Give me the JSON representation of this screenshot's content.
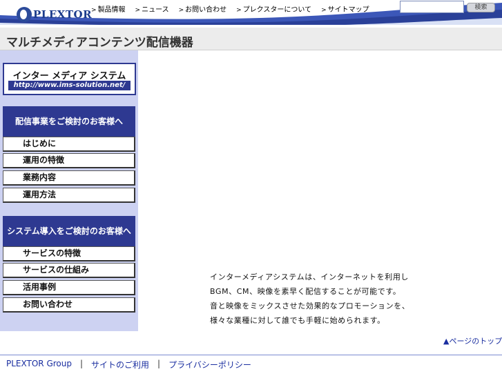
{
  "header": {
    "logo_text": "PLEXTOR",
    "nav": [
      {
        "label": "製品情報"
      },
      {
        "label": "ニュース"
      },
      {
        "label": "お問い合わせ"
      },
      {
        "label": "プレクスターについて"
      },
      {
        "label": "サイトマップ"
      }
    ],
    "search": {
      "value": "",
      "button_label": "検索"
    }
  },
  "page": {
    "title": "マルチメディアコンテンツ配信機器"
  },
  "sidebar": {
    "banner": {
      "title": "インター メディア システム",
      "url": "http://www.ims-solution.net/"
    },
    "section1": {
      "heading": "配信事業をご検討のお客様へ",
      "items": [
        {
          "label": "はじめに"
        },
        {
          "label": "運用の特徴"
        },
        {
          "label": "業務内容"
        },
        {
          "label": "運用方法"
        }
      ]
    },
    "section2": {
      "heading": "システム導入をご検討のお客様へ",
      "items": [
        {
          "label": "サービスの特徴"
        },
        {
          "label": "サービスの仕組み"
        },
        {
          "label": "活用事例"
        },
        {
          "label": "お問い合わせ"
        }
      ]
    }
  },
  "main": {
    "intro_lines": [
      "インターメディアシステムは、インターネットを利用し",
      "BGM、CM、映像を素早く配信することが可能です。",
      "音と映像をミックスさせた効果的なプロモーションを、",
      "様々な業種に対して誰でも手軽に始められます。"
    ],
    "page_top_label": "▲ページのトップへ"
  },
  "footer": {
    "group_label": "PLEXTOR Group",
    "link1": "サイトのご利用",
    "link2": "プライバシーポリシー"
  },
  "colors": {
    "sidebar_bg": "#cdd2f2",
    "sidebar_head": "#2e3991",
    "link_blue": "#1a2ea0"
  }
}
